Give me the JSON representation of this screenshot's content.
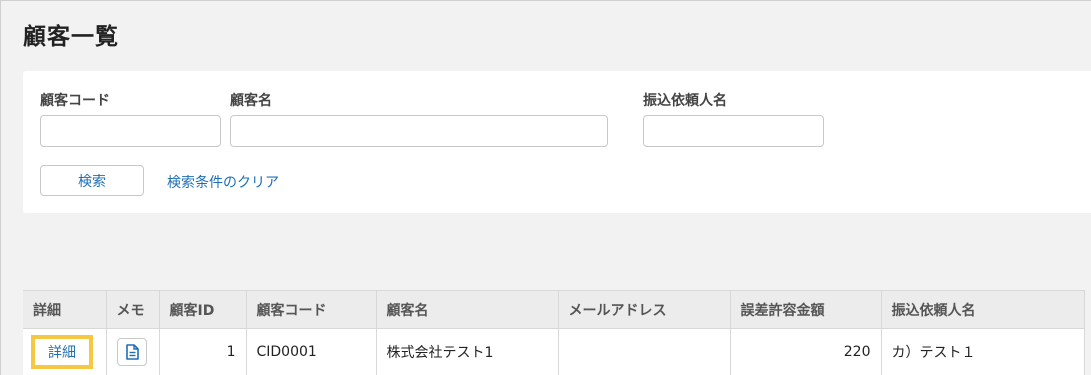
{
  "page": {
    "title": "顧客一覧"
  },
  "search": {
    "customer_code_label": "顧客コード",
    "customer_code_value": "",
    "customer_name_label": "顧客名",
    "customer_name_value": "",
    "transfer_name_label": "振込依頼人名",
    "transfer_name_value": "",
    "search_button_label": "検索",
    "clear_link_label": "検索条件のクリア"
  },
  "table": {
    "headers": [
      "詳細",
      "メモ",
      "顧客ID",
      "顧客コード",
      "顧客名",
      "メールアドレス",
      "誤差許容金額",
      "振込依頼人名"
    ],
    "rows": [
      {
        "detail_label": "詳細",
        "memo_icon": "document-icon",
        "customer_id": "1",
        "customer_code": "CID0001",
        "customer_name": "株式会社テスト1",
        "email": "",
        "tolerance_amount": "220",
        "transfer_name": "カ）テスト１"
      }
    ]
  },
  "colors": {
    "link": "#1f6fb5",
    "highlight": "#f4c842",
    "header_bg": "#ececec",
    "page_bg": "#f2f2f2"
  }
}
